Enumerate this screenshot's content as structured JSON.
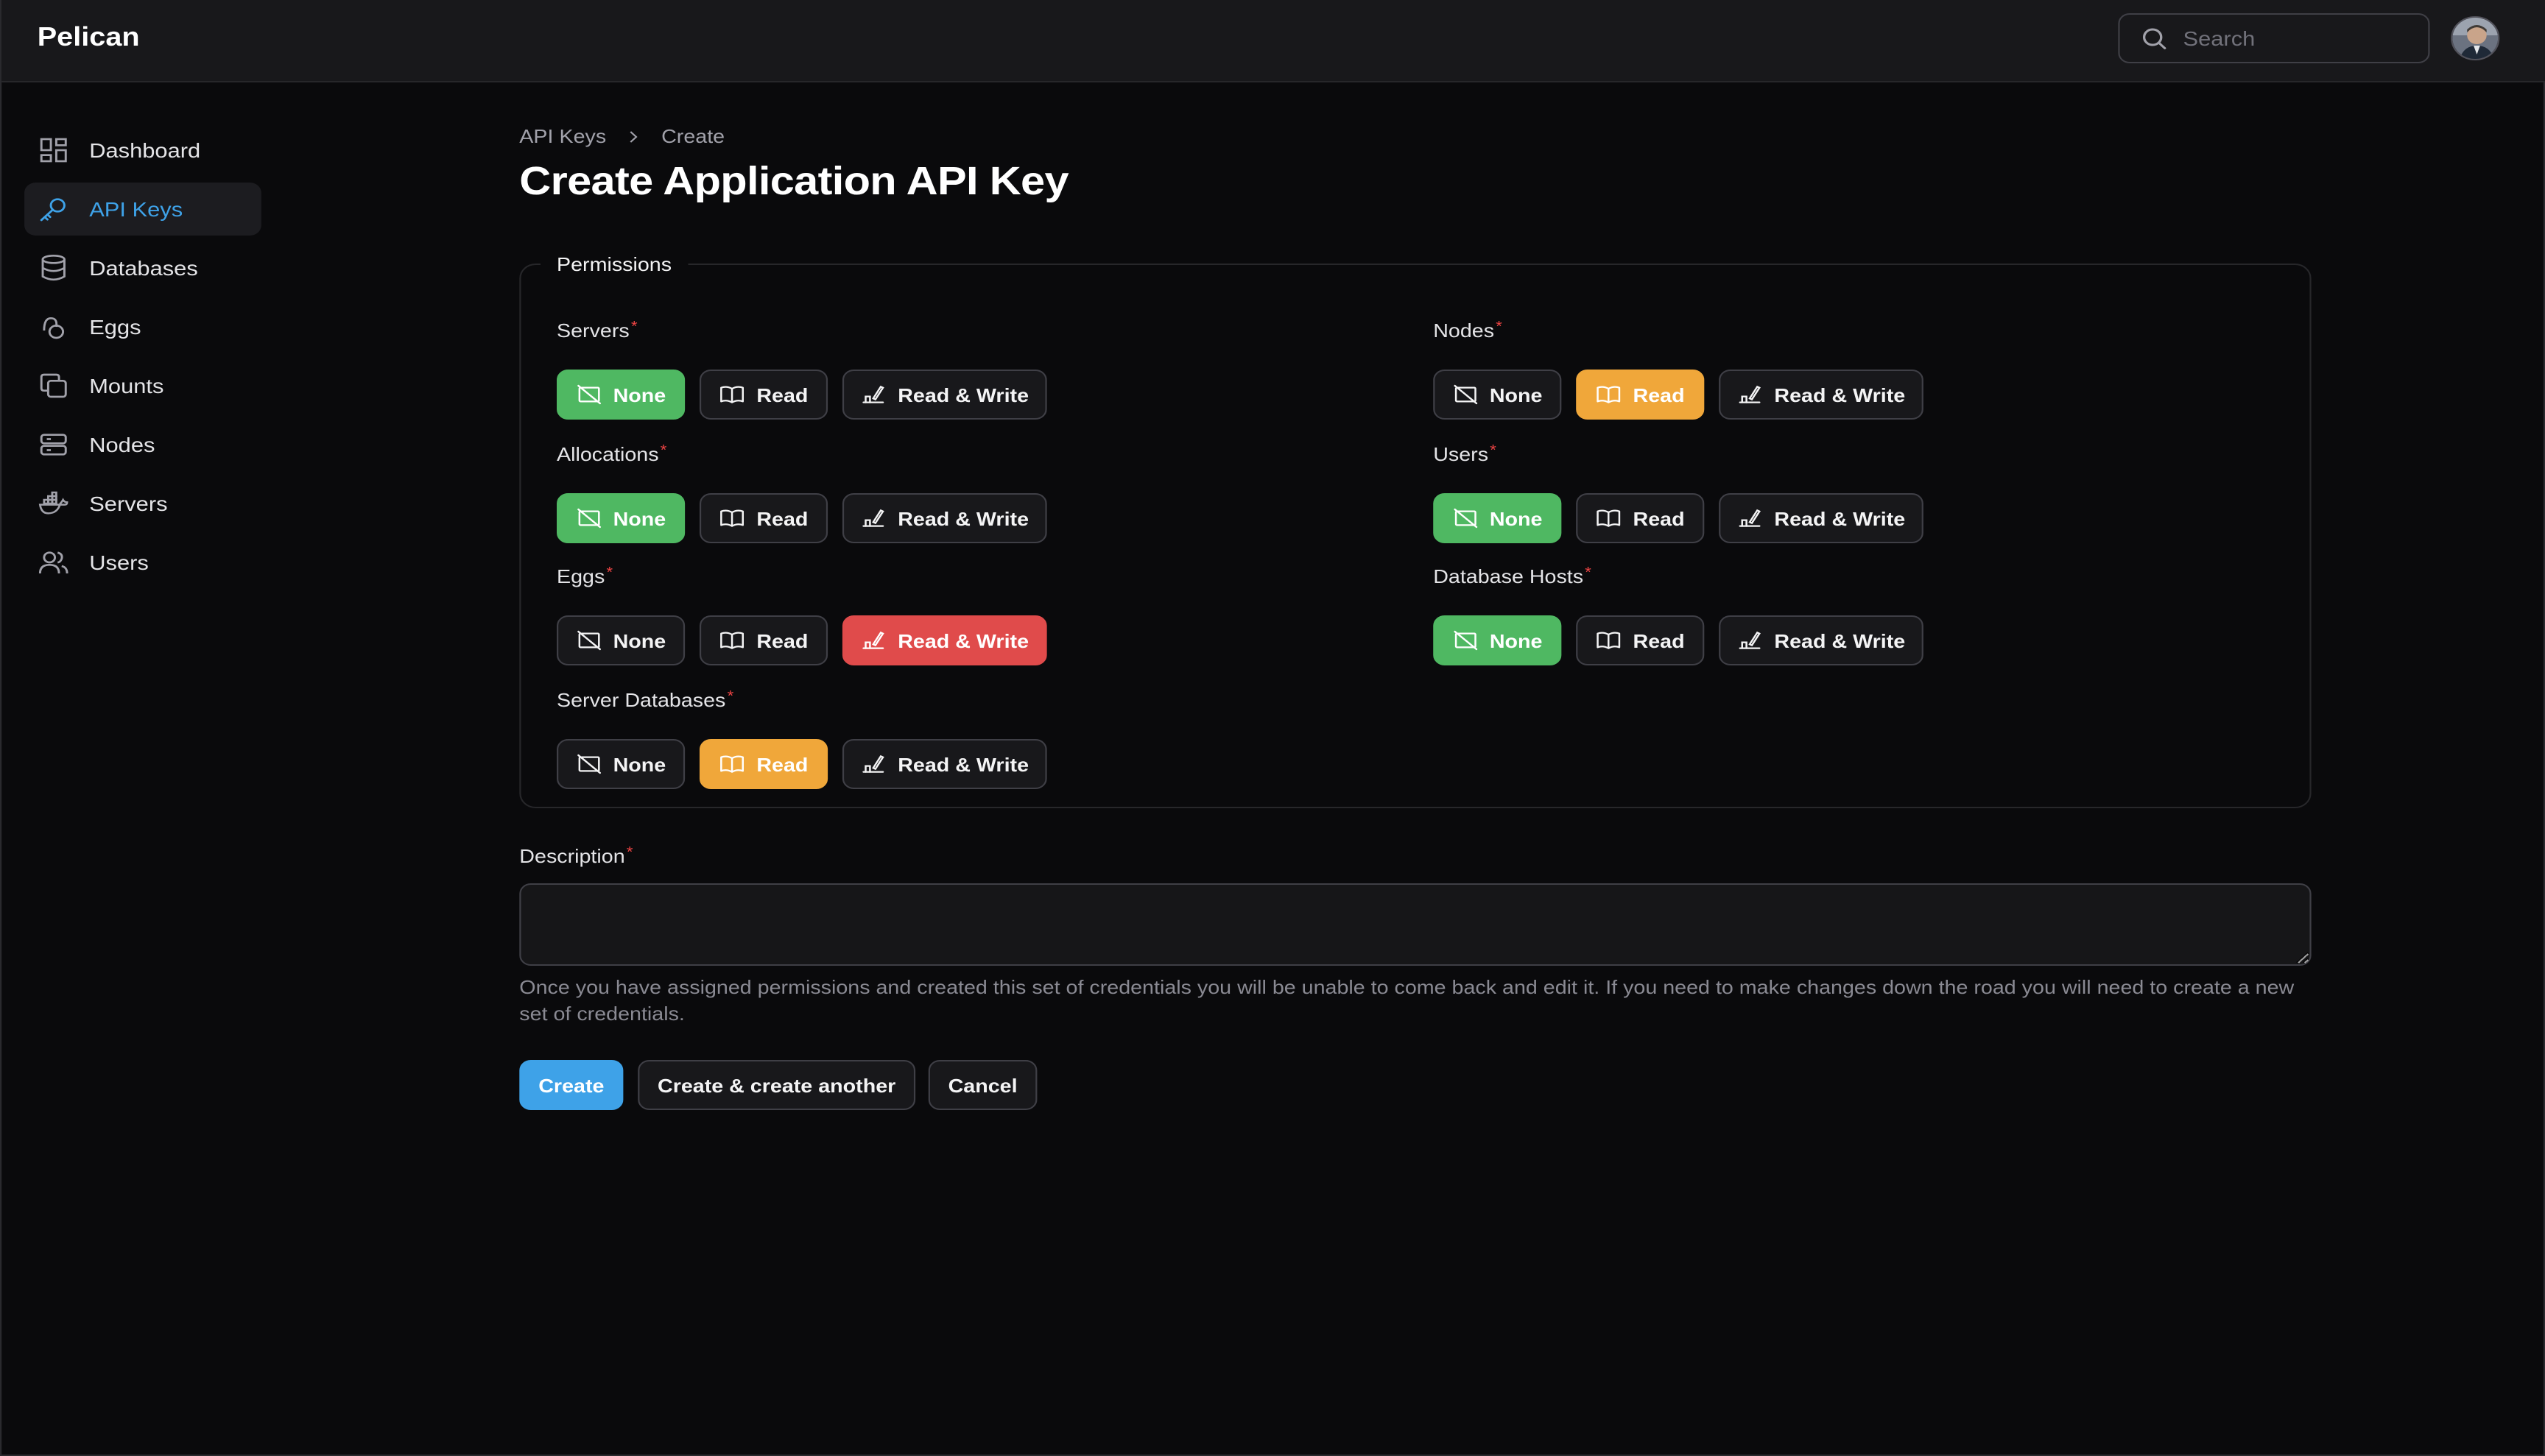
{
  "app": {
    "brand": "Pelican"
  },
  "header": {
    "search_placeholder": "Search"
  },
  "sidebar": {
    "items": [
      {
        "label": "Dashboard",
        "icon": "dashboard-icon"
      },
      {
        "label": "API Keys",
        "icon": "key-icon",
        "active": true
      },
      {
        "label": "Databases",
        "icon": "database-icon"
      },
      {
        "label": "Eggs",
        "icon": "egg-icon"
      },
      {
        "label": "Mounts",
        "icon": "layers-icon"
      },
      {
        "label": "Nodes",
        "icon": "server-icon"
      },
      {
        "label": "Servers",
        "icon": "docker-icon"
      },
      {
        "label": "Users",
        "icon": "users-icon"
      }
    ]
  },
  "breadcrumb": {
    "parent": "API Keys",
    "current": "Create"
  },
  "page_title": "Create Application API Key",
  "permissions": {
    "legend": "Permissions",
    "options": {
      "none": "None",
      "read": "Read",
      "read_write": "Read & Write"
    },
    "groups": [
      {
        "label": "Servers",
        "selected": "None"
      },
      {
        "label": "Nodes",
        "selected": "Read"
      },
      {
        "label": "Allocations",
        "selected": "None"
      },
      {
        "label": "Users",
        "selected": "None"
      },
      {
        "label": "Eggs",
        "selected": "Read & Write"
      },
      {
        "label": "Database Hosts",
        "selected": "None"
      },
      {
        "label": "Server Databases",
        "selected": "Read"
      }
    ]
  },
  "description": {
    "label": "Description",
    "value": "",
    "hint": "Once you have assigned permissions and created this set of credentials you will be unable to come back and edit it. If you need to make changes down the road you will need to create a new set of credentials."
  },
  "actions": {
    "create": "Create",
    "create_another": "Create & create another",
    "cancel": "Cancel"
  },
  "colors": {
    "accent": "#3ea2e8",
    "none_selected": "#4fb862",
    "read_selected": "#f0a73a",
    "read_write_selected": "#e04b4b",
    "required_marker": "#ef4444"
  }
}
